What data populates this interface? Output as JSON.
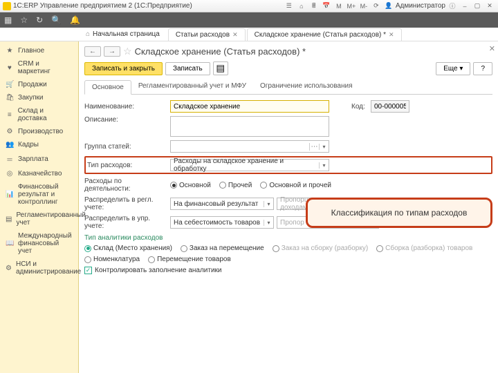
{
  "window": {
    "title": "1С:ERP Управление предприятием 2  (1С:Предприятие)",
    "user": "Администратор"
  },
  "tabs": {
    "home": "Начальная страница",
    "t1": "Статьи расходов",
    "t2": "Складское хранение (Статья расходов) *"
  },
  "sidebar": [
    "Главное",
    "CRM и маркетинг",
    "Продажи",
    "Закупки",
    "Склад и доставка",
    "Производство",
    "Кадры",
    "Зарплата",
    "Казначейство",
    "Финансовый результат и контроллинг",
    "Регламентированный учет",
    "Международный финансовый учет",
    "НСИ и администрирование"
  ],
  "page": {
    "title": "Складское хранение (Статья расходов) *",
    "save_close": "Записать и закрыть",
    "save": "Записать",
    "more": "Еще",
    "subtabs": {
      "main": "Основное",
      "reg": "Регламентированный учет и МФУ",
      "restrict": "Ограничение использования"
    }
  },
  "form": {
    "name_label": "Наименование:",
    "name_value": "Складское хранение",
    "code_label": "Код:",
    "code_value": "00-000005",
    "desc_label": "Описание:",
    "group_label": "Группа статей:",
    "type_label": "Тип расходов:",
    "type_value": "Расходы на складское хранение и обработку",
    "activity_label": "Расходы по деятельности:",
    "activity": {
      "r1": "Основной",
      "r2": "Прочей",
      "r3": "Основной и прочей"
    },
    "distr_reg_label": "Распределить в регл. учете:",
    "distr_reg_value": "На финансовый результат",
    "distr_reg_right": "Пропорционально доходам",
    "distr_upr_label": "Распределить в упр. учете:",
    "distr_upr_value": "На себестоимость товаров",
    "distr_upr_right": "Пропор",
    "analytics_head": "Тип аналитики расходов",
    "analytics": {
      "r1": "Склад (Место хранения)",
      "r2": "Заказ на перемещение",
      "r3": "Заказ на сборку (разборку)",
      "r4": "Сборка (разборка) товаров",
      "r5": "Номенклатура",
      "r6": "Перемещение товаров"
    },
    "control_check": "Контролировать заполнение аналитики"
  },
  "callout": "Классификация по типам расходов"
}
